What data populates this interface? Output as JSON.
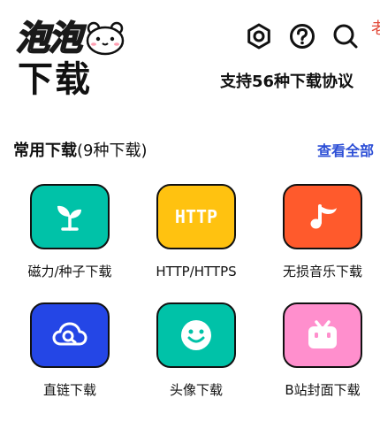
{
  "brand": {
    "logo_text": "泡泡"
  },
  "header": {
    "title": "下载",
    "tagline": "支持56种下载协议"
  },
  "toolbar": {
    "icons": [
      "settings-hex-icon",
      "help-circle-icon",
      "search-icon"
    ],
    "edge_glyph": "老"
  },
  "section": {
    "title": "常用下载",
    "count": "(9种下载)",
    "see_all": "查看全部"
  },
  "items": [
    {
      "label": "磁力/种子下载",
      "icon": "sprout-icon",
      "color": "#00c2a8"
    },
    {
      "label": "HTTP/HTTPS",
      "icon": "http-icon",
      "icon_text": "HTTP",
      "color": "#ffc210"
    },
    {
      "label": "无损音乐下载",
      "icon": "music-note-icon",
      "color": "#ff5a2c"
    },
    {
      "label": "直链下载",
      "icon": "cloud-link-icon",
      "color": "#2446e6"
    },
    {
      "label": "头像下载",
      "icon": "smiley-icon",
      "color": "#00c2a8"
    },
    {
      "label": "B站封面下载",
      "icon": "tv-icon",
      "color": "#ff8fcd"
    }
  ],
  "colors": {
    "accent": "#2d4fd6",
    "text": "#111111",
    "background": "#ffffff"
  }
}
